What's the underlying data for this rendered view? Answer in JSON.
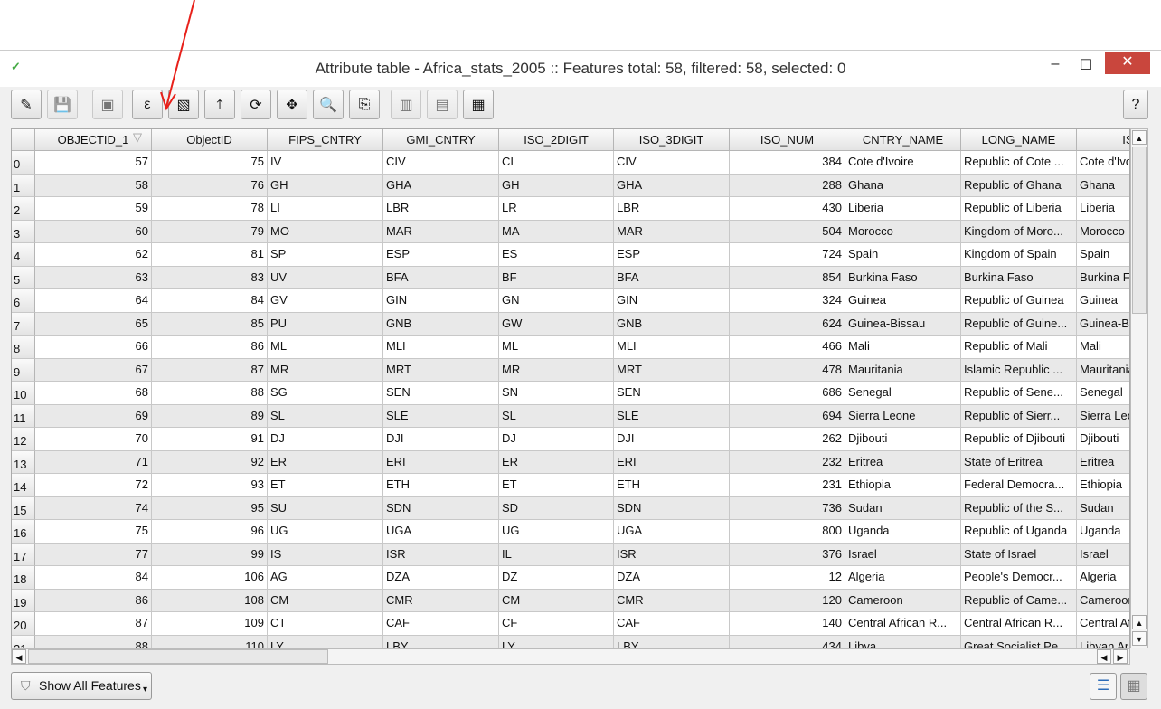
{
  "window": {
    "title": "Attribute table - Africa_stats_2005 :: Features total: 58, filtered: 58, selected: 0",
    "minimize": "–",
    "maximize": "☐",
    "close": "✕"
  },
  "toolbar": {
    "buttons": [
      {
        "name": "toggle-editing",
        "icon": "✎",
        "enabled": true
      },
      {
        "name": "save-edits",
        "icon": "💾",
        "enabled": false
      },
      {
        "name": "delete-selected",
        "icon": "▣",
        "enabled": false
      },
      {
        "name": "select-by-expression",
        "icon": "ε",
        "enabled": true
      },
      {
        "name": "unselect-all",
        "icon": "▧",
        "enabled": true
      },
      {
        "name": "move-selection-to-top",
        "icon": "⤒",
        "enabled": true
      },
      {
        "name": "invert-selection",
        "icon": "⟳",
        "enabled": true
      },
      {
        "name": "pan-map-to-selected",
        "icon": "✥",
        "enabled": true
      },
      {
        "name": "zoom-map-to-selected",
        "icon": "🔍",
        "enabled": true
      },
      {
        "name": "copy-selected-rows",
        "icon": "⎘",
        "enabled": true
      },
      {
        "name": "delete-column",
        "icon": "▥",
        "enabled": false
      },
      {
        "name": "new-column",
        "icon": "▤",
        "enabled": false
      },
      {
        "name": "field-calculator",
        "icon": "▦",
        "enabled": true
      }
    ],
    "help": "?"
  },
  "table": {
    "columns": [
      "",
      "OBJECTID_1",
      "ObjectID",
      "FIPS_CNTRY",
      "GMI_CNTRY",
      "ISO_2DIGIT",
      "ISO_3DIGIT",
      "ISO_NUM",
      "CNTRY_NAME",
      "LONG_NAME",
      "ISOSH"
    ],
    "sort_indicator": "▽",
    "rows": [
      [
        "0",
        "57",
        "75",
        "IV",
        "CIV",
        "CI",
        "CIV",
        "384",
        "Cote d'Ivoire",
        "Republic of Cote ...",
        "Cote d'Ivoire"
      ],
      [
        "1",
        "58",
        "76",
        "GH",
        "GHA",
        "GH",
        "GHA",
        "288",
        "Ghana",
        "Republic of Ghana",
        "Ghana"
      ],
      [
        "2",
        "59",
        "78",
        "LI",
        "LBR",
        "LR",
        "LBR",
        "430",
        "Liberia",
        "Republic of Liberia",
        "Liberia"
      ],
      [
        "3",
        "60",
        "79",
        "MO",
        "MAR",
        "MA",
        "MAR",
        "504",
        "Morocco",
        "Kingdom of Moro...",
        "Morocco"
      ],
      [
        "4",
        "62",
        "81",
        "SP",
        "ESP",
        "ES",
        "ESP",
        "724",
        "Spain",
        "Kingdom of Spain",
        "Spain"
      ],
      [
        "5",
        "63",
        "83",
        "UV",
        "BFA",
        "BF",
        "BFA",
        "854",
        "Burkina Faso",
        "Burkina Faso",
        "Burkina Faso"
      ],
      [
        "6",
        "64",
        "84",
        "GV",
        "GIN",
        "GN",
        "GIN",
        "324",
        "Guinea",
        "Republic of Guinea",
        "Guinea"
      ],
      [
        "7",
        "65",
        "85",
        "PU",
        "GNB",
        "GW",
        "GNB",
        "624",
        "Guinea-Bissau",
        "Republic of Guine...",
        "Guinea-Bissau"
      ],
      [
        "8",
        "66",
        "86",
        "ML",
        "MLI",
        "ML",
        "MLI",
        "466",
        "Mali",
        "Republic of Mali",
        "Mali"
      ],
      [
        "9",
        "67",
        "87",
        "MR",
        "MRT",
        "MR",
        "MRT",
        "478",
        "Mauritania",
        "Islamic Republic ...",
        "Mauritania"
      ],
      [
        "10",
        "68",
        "88",
        "SG",
        "SEN",
        "SN",
        "SEN",
        "686",
        "Senegal",
        "Republic of Sene...",
        "Senegal"
      ],
      [
        "11",
        "69",
        "89",
        "SL",
        "SLE",
        "SL",
        "SLE",
        "694",
        "Sierra Leone",
        "Republic of Sierr...",
        "Sierra Leone"
      ],
      [
        "12",
        "70",
        "91",
        "DJ",
        "DJI",
        "DJ",
        "DJI",
        "262",
        "Djibouti",
        "Republic of Djibouti",
        "Djibouti"
      ],
      [
        "13",
        "71",
        "92",
        "ER",
        "ERI",
        "ER",
        "ERI",
        "232",
        "Eritrea",
        "State of Eritrea",
        "Eritrea"
      ],
      [
        "14",
        "72",
        "93",
        "ET",
        "ETH",
        "ET",
        "ETH",
        "231",
        "Ethiopia",
        "Federal Democra...",
        "Ethiopia"
      ],
      [
        "15",
        "74",
        "95",
        "SU",
        "SDN",
        "SD",
        "SDN",
        "736",
        "Sudan",
        "Republic of the S...",
        "Sudan"
      ],
      [
        "16",
        "75",
        "96",
        "UG",
        "UGA",
        "UG",
        "UGA",
        "800",
        "Uganda",
        "Republic of Uganda",
        "Uganda"
      ],
      [
        "17",
        "77",
        "99",
        "IS",
        "ISR",
        "IL",
        "ISR",
        "376",
        "Israel",
        "State of Israel",
        "Israel"
      ],
      [
        "18",
        "84",
        "106",
        "AG",
        "DZA",
        "DZ",
        "DZA",
        "12",
        "Algeria",
        "People's Democr...",
        "Algeria"
      ],
      [
        "19",
        "86",
        "108",
        "CM",
        "CMR",
        "CM",
        "CMR",
        "120",
        "Cameroon",
        "Republic of Came...",
        "Cameroon"
      ],
      [
        "20",
        "87",
        "109",
        "CT",
        "CAF",
        "CF",
        "CAF",
        "140",
        "Central African R...",
        "Central African R...",
        "Central African"
      ],
      [
        "21",
        "88",
        "110",
        "LY",
        "LBY",
        "LY",
        "LBY",
        "434",
        "Libya",
        "Great Socialist Pe...",
        "Libyan Ar"
      ]
    ]
  },
  "footer": {
    "filter_button": "Show All Features",
    "dropdown": "▾"
  },
  "colors": {
    "annotation_arrow": "#e8201a",
    "close_button": "#c9463d"
  }
}
